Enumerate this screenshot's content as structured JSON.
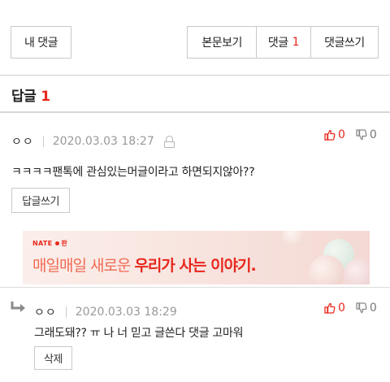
{
  "top_bar": {
    "my_comments": "내 댓글",
    "view_post": "본문보기",
    "comments_label": "댓글",
    "comments_count": "1",
    "write_comment": "댓글쓰기"
  },
  "reply_header": {
    "title": "답글",
    "count": "1"
  },
  "comment": {
    "nickname": "ㅇㅇ",
    "datetime": "2020.03.03 18:27",
    "text": "ㅋㅋㅋㅋ팬톡에 관심있는머글이라고 하면되지않아??",
    "up_count": "0",
    "down_count": "0",
    "reply_button": "답글쓰기"
  },
  "ad": {
    "brand": "NATE",
    "brand_suffix": "판",
    "text_light": "매일매일 새로운",
    "text_bold": "우리가 사는 이야기."
  },
  "reply": {
    "nickname": "ㅇㅇ",
    "datetime": "2020.03.03 18:29",
    "text": "그래도돼?? ㅠ 나 너 믿고 글쓴다 댓글 고마워",
    "up_count": "0",
    "down_count": "0",
    "delete_button": "삭제"
  },
  "colors": {
    "accent": "#e8271d",
    "border": "#c9c9c9"
  },
  "icons": {
    "thumb_up": "thumb-up-icon",
    "thumb_down": "thumb-down-icon",
    "lock": "lock-icon",
    "reply_arrow": "reply-arrow-icon"
  }
}
